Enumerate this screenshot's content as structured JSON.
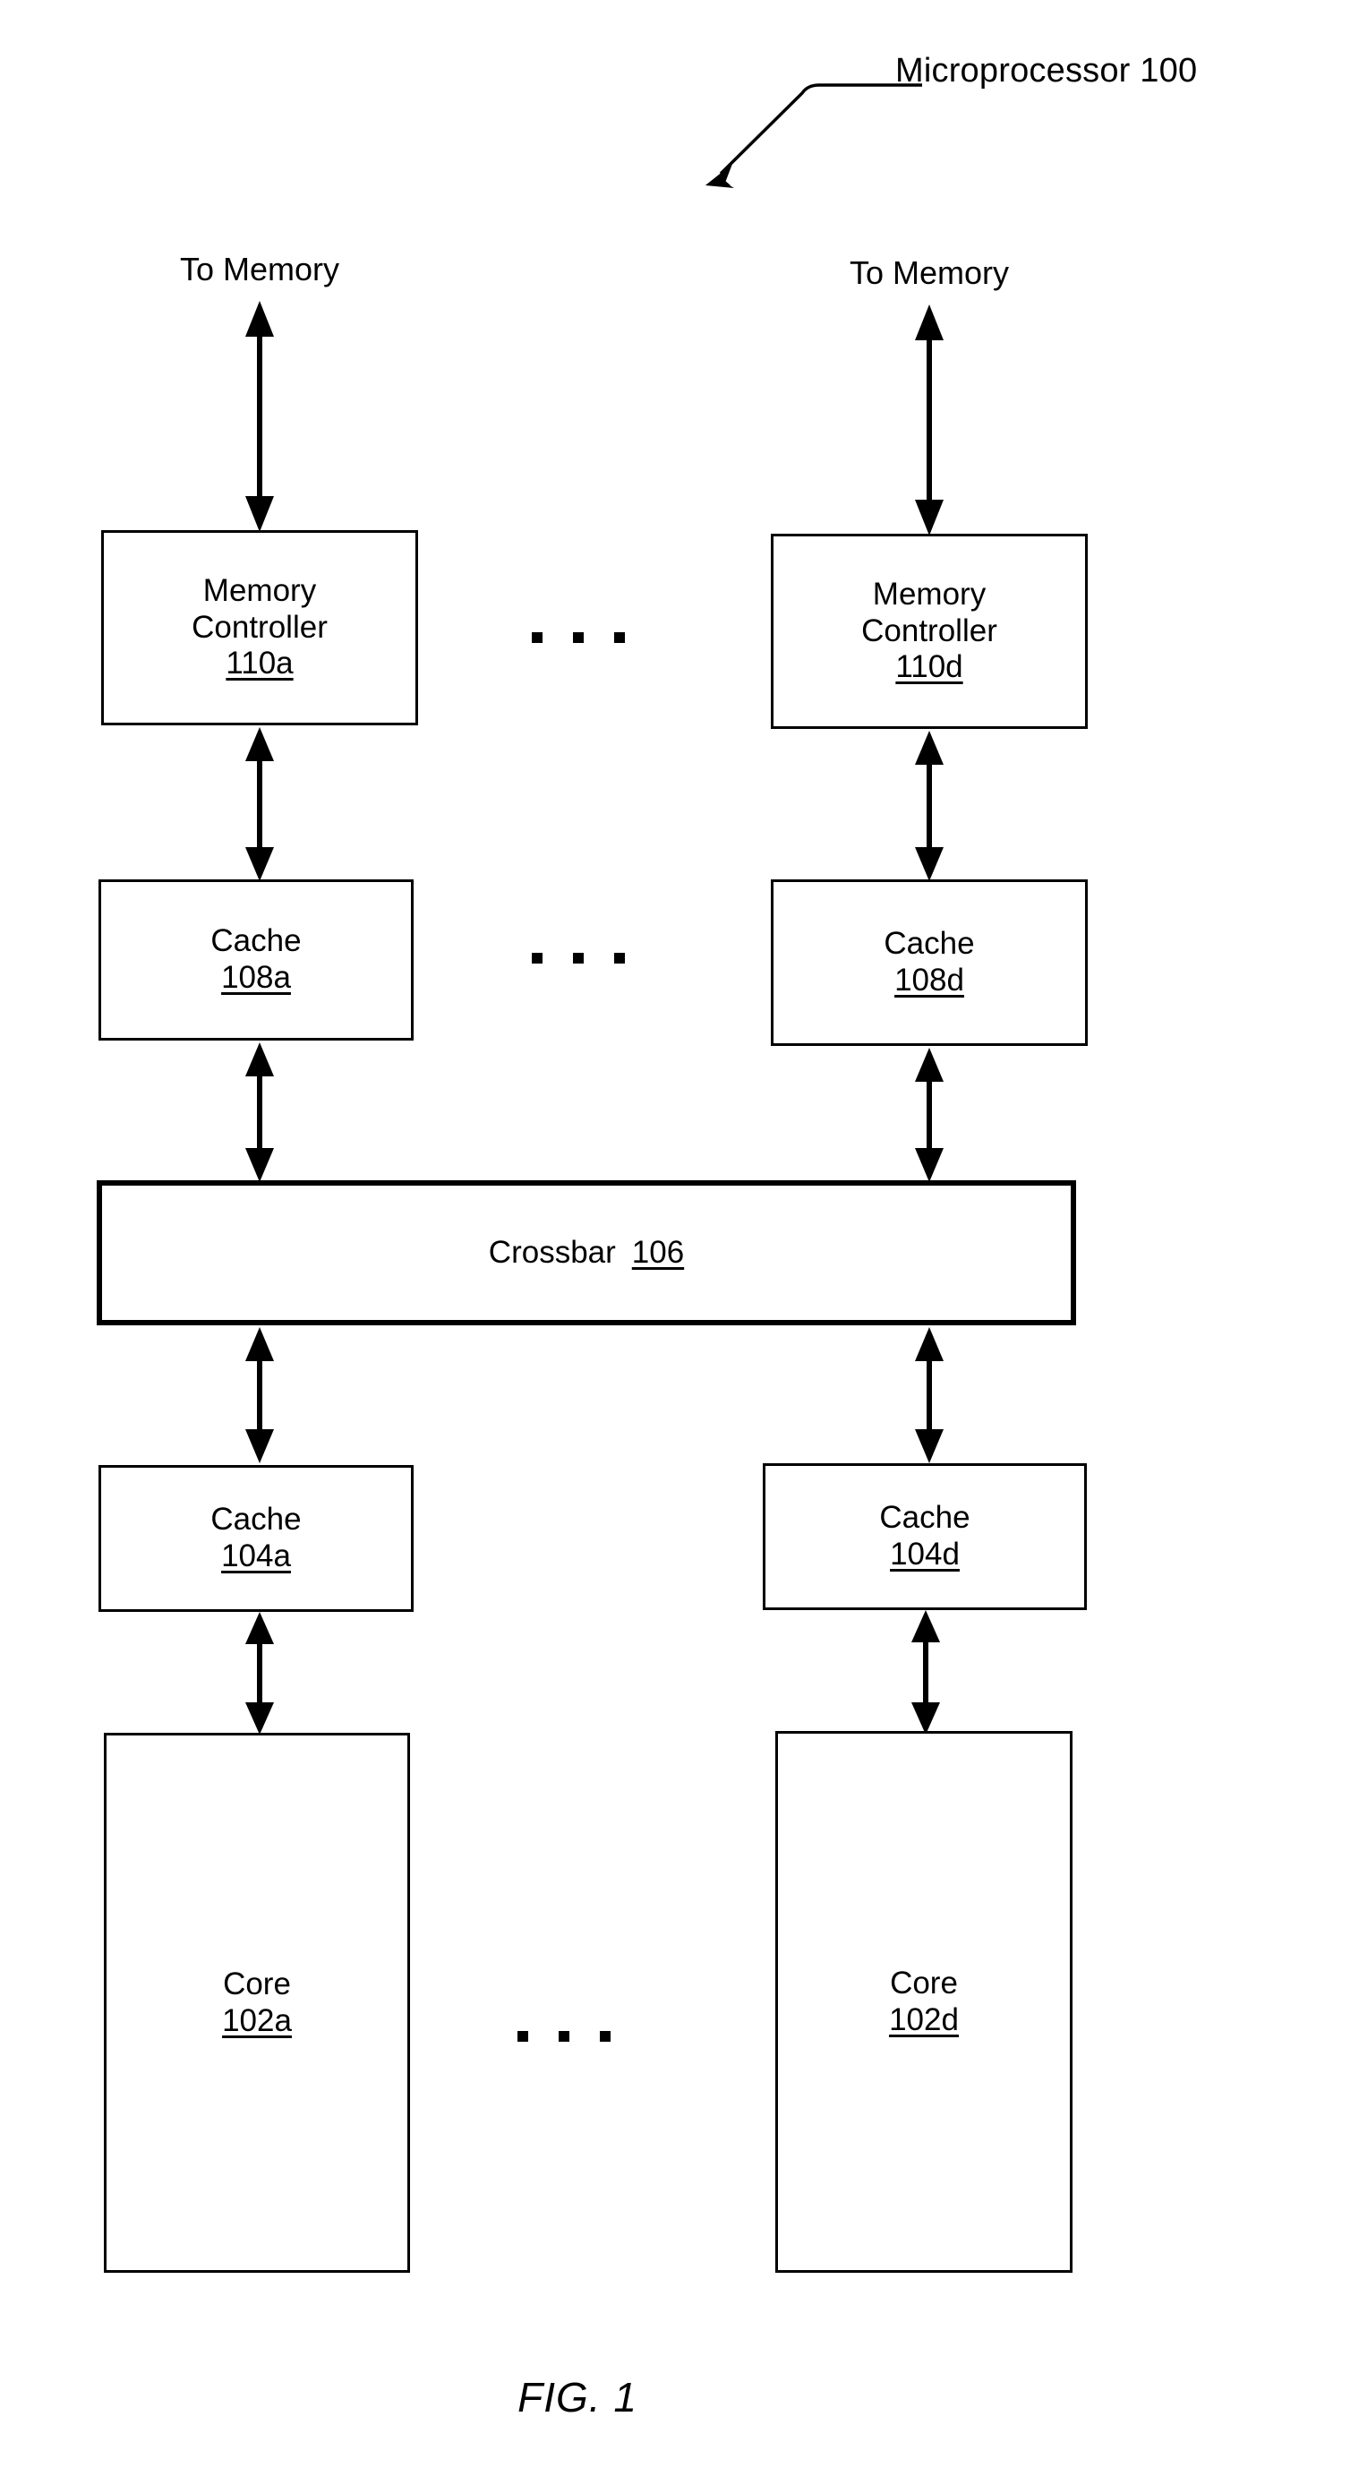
{
  "figure": {
    "title": "Microprocessor 100",
    "caption": "FIG. 1",
    "leader_icon": "leader-arrow-icon"
  },
  "memory_labels": {
    "left": "To Memory",
    "right": "To Memory"
  },
  "ellipsis_glyph": "▪ ▪ ▪",
  "rows": {
    "memory_controller": {
      "left": {
        "label": "Memory Controller",
        "line1": "Memory",
        "line2": "Controller",
        "ref": "110a"
      },
      "right": {
        "label": "Memory Controller",
        "line1": "Memory",
        "line2": "Controller",
        "ref": "110d"
      },
      "has_ellipsis": true
    },
    "cache_upper": {
      "left": {
        "label": "Cache",
        "ref": "108a"
      },
      "right": {
        "label": "Cache",
        "ref": "108d"
      },
      "has_ellipsis": true
    },
    "crossbar": {
      "label": "Crossbar",
      "ref": "106"
    },
    "cache_lower": {
      "left": {
        "label": "Cache",
        "ref": "104a"
      },
      "right": {
        "label": "Cache",
        "ref": "104d"
      },
      "has_ellipsis": false
    },
    "core": {
      "left": {
        "label": "Core",
        "ref": "102a"
      },
      "right": {
        "label": "Core",
        "ref": "102d"
      },
      "has_ellipsis": true
    }
  },
  "colors": {
    "ink": "#000000",
    "paper": "#ffffff"
  }
}
